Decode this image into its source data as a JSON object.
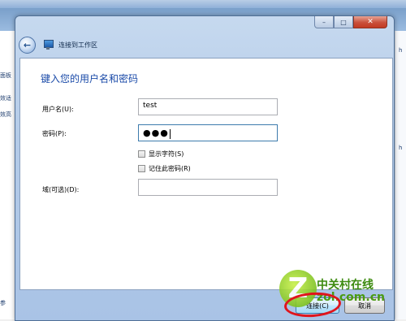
{
  "dialog": {
    "title": "连接到工作区",
    "heading": "键入您的用户名和密码",
    "caption": {
      "minimize": "–",
      "maximize": "□",
      "close": "✕"
    },
    "back_icon": "back-arrow-icon",
    "network_icon": "network-workplace-icon"
  },
  "form": {
    "username_label": "用户名(U):",
    "username_value": "test",
    "password_label": "密码(P):",
    "password_value": "●●●",
    "show_chars_label": "显示字符(S)",
    "show_chars_checked": false,
    "remember_label": "记住此密码(R)",
    "remember_checked": false,
    "domain_label": "域(可选)(D):",
    "domain_value": ""
  },
  "footer": {
    "connect_label": "连接(C)",
    "cancel_label": "取消"
  },
  "background": {
    "left_items": [
      "面板",
      "效适",
      "效高",
      "参"
    ],
    "right_items": [
      "h",
      "h"
    ]
  },
  "watermark": {
    "logo_letter": "Z",
    "name": "中关村在线",
    "url": "zol.com.cn"
  },
  "colors": {
    "heading": "#1a4aa8",
    "annotation": "#e0141c",
    "watermark": "#4a9a12"
  }
}
